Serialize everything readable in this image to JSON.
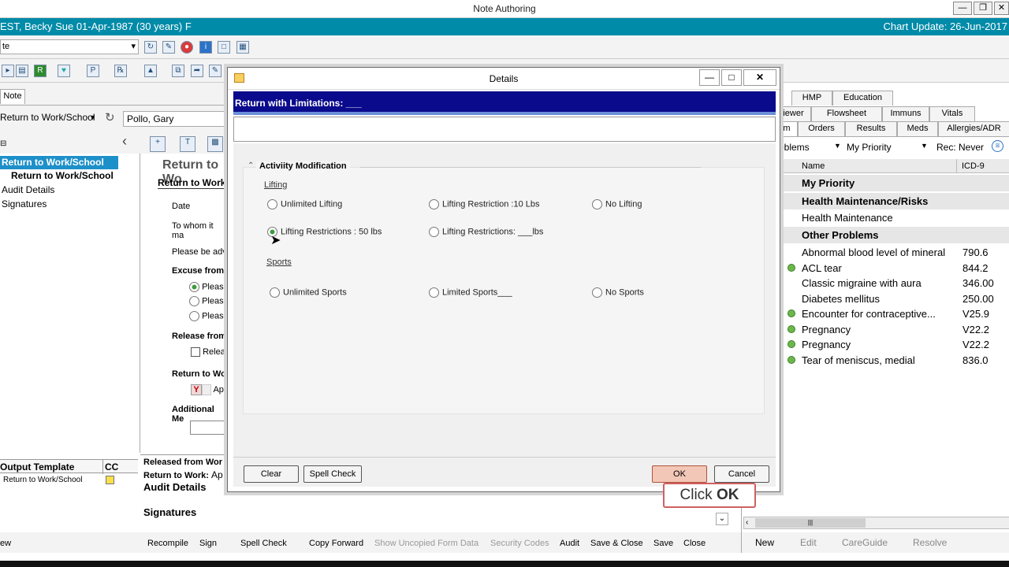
{
  "window": {
    "title": "Note Authoring"
  },
  "patient": {
    "banner": "EST, Becky Sue  01-Apr-1987  (30 years)  F",
    "chart_update": "Chart Update: 26-Jun-2017"
  },
  "left": {
    "combo": "te",
    "note_tab": "Note",
    "type_combo": "Return to Work/School",
    "provider": "Pollo, Gary",
    "tree": [
      "Return to Work/School",
      "Return to Work/School",
      "Audit Details",
      "Signatures"
    ],
    "output_header": "Output Template",
    "cc_header": "CC",
    "output_row": "Return to Work/School"
  },
  "form": {
    "heading": "Return to Wo",
    "subheading": "Return to Work",
    "date": "Date",
    "to_whom": "To whom it ma",
    "please_adv": "Please be adv",
    "excuse": "Excuse from",
    "pleas": [
      "Pleas",
      "Pleas",
      "Pleas"
    ],
    "release_from": "Release from",
    "relea": "Relea",
    "return_to_wo": "Return to Wo",
    "y": "Y",
    "ap": "Ap",
    "additional": "Additional Me",
    "preview": [
      "Released from Wor",
      "Return to Work:",
      "Ap",
      "Audit Details",
      "Signatures"
    ]
  },
  "bottom": {
    "left_label": "ew",
    "actions": [
      "Recompile",
      "Sign",
      "Spell Check",
      "Copy Forward",
      "Show Uncopied Form Data",
      "Security Codes",
      "Audit",
      "Save & Close",
      "Save",
      "Close"
    ],
    "right_actions": [
      "New",
      "Edit",
      "CareGuide",
      "Resolve"
    ]
  },
  "right": {
    "tabs_row1": [
      "HMP",
      "Education"
    ],
    "tabs_row2": [
      "iewer",
      "Flowsheet",
      "Immuns",
      "Vitals"
    ],
    "tabs_row3": [
      "m",
      "Orders",
      "Results",
      "Meds",
      "Allergies/ADR"
    ],
    "filter_problems": "roblems",
    "filter_priority": "My Priority",
    "rec": "Rec: Never",
    "col_name": "Name",
    "col_icd": "ICD-9",
    "groups": [
      "My Priority",
      "Health Maintenance/Risks"
    ],
    "health_maint": "Health Maintenance",
    "other_group": "Other Problems",
    "problems": [
      {
        "name": "Abnormal blood level of mineral",
        "code": "790.6",
        "dot": false
      },
      {
        "name": "ACL tear",
        "code": "844.2",
        "dot": true
      },
      {
        "name": "Classic migraine with aura",
        "code": "346.00",
        "dot": false
      },
      {
        "name": "Diabetes mellitus",
        "code": "250.00",
        "dot": false
      },
      {
        "name": "Encounter for contraceptive...",
        "code": "V25.9",
        "dot": true
      },
      {
        "name": "Pregnancy",
        "code": "V22.2",
        "dot": true
      },
      {
        "name": "Pregnancy",
        "code": "V22.2",
        "dot": true
      },
      {
        "name": "Tear of meniscus, medial",
        "code": "836.0",
        "dot": true
      }
    ]
  },
  "dialog": {
    "title": "Details",
    "header": "Return with Limitations: ___",
    "section": "Activiity Modification",
    "lifting_label": "Lifting",
    "lifting": [
      "Unlimited Lifting",
      "Lifting Restriction :10 Lbs",
      "No Lifting",
      "Lifting Restrictions : 50 lbs",
      "Lifting Restrictions: ___lbs"
    ],
    "sports_label": "Sports",
    "sports": [
      "Unlimited Sports",
      "Limited Sports___",
      "No Sports"
    ],
    "clear": "Clear",
    "spell": "Spell Check",
    "ok": "OK",
    "cancel": "Cancel"
  },
  "callout": {
    "prefix": "Click ",
    "bold": "OK"
  },
  "colors": {
    "banner": "#008ba8",
    "dialog_header": "#0a0a8c",
    "selection": "#1e90c9"
  }
}
